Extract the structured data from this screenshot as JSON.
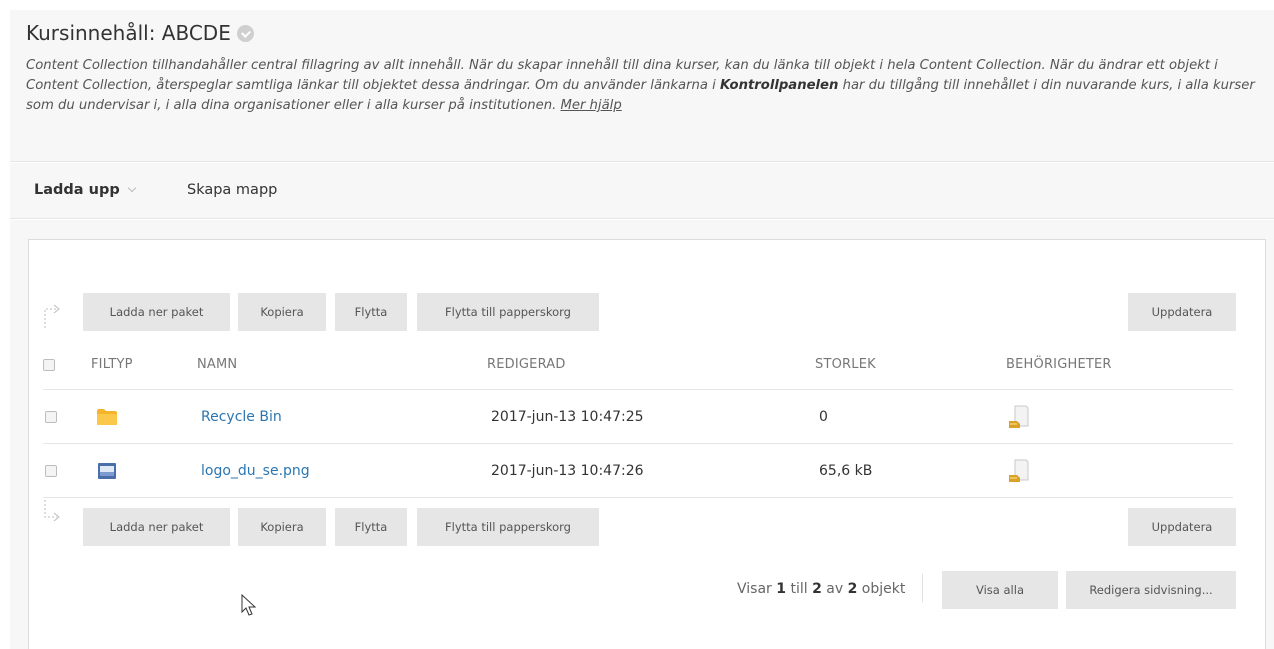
{
  "header": {
    "title": "Kursinnehåll: ABCDE",
    "description_part1": "Content Collection tillhandahåller central fillagring av allt innehåll. När du skapar innehåll till dina kurser, kan du länka till objekt i hela Content Collection. När du ändrar ett objekt i Content Collection, återspeglar samtliga länkar till objektet dessa ändringar. Om du använder länkarna i ",
    "description_bold": "Kontrollpanelen",
    "description_part2": " har du tillgång till innehållet i din nuvarande kurs, i alla kurser som du undervisar i, i alla dina organisationer eller i alla kurser på institutionen. ",
    "help_link": "Mer hjälp"
  },
  "actionbar": {
    "upload_label": "Ladda upp",
    "create_folder_label": "Skapa mapp"
  },
  "toolbar": {
    "download_package": "Ladda ner paket",
    "copy": "Kopiera",
    "move": "Flytta",
    "move_to_trash": "Flytta till papperskorg",
    "refresh": "Uppdatera"
  },
  "table": {
    "columns": {
      "filetype": "FILTYP",
      "name": "NAMN",
      "edited": "REDIGERAD",
      "size": "STORLEK",
      "permissions": "BEHÖRIGHETER"
    },
    "rows": [
      {
        "icon": "folder-icon",
        "name": "Recycle Bin",
        "edited": "2017-jun-13 10:47:25",
        "size": "0"
      },
      {
        "icon": "image-file-icon",
        "name": "logo_du_se.png",
        "edited": "2017-jun-13 10:47:26",
        "size": "65,6 kB"
      }
    ]
  },
  "footer": {
    "showing_prefix": "Visar ",
    "showing_from": "1",
    "showing_mid": " till ",
    "showing_to": "2",
    "showing_of": " av ",
    "showing_total": "2",
    "showing_suffix": " objekt",
    "show_all": "Visa alla",
    "edit_paging": "Redigera sidvisning..."
  },
  "colors": {
    "link": "#2b76b2",
    "button_bg": "#e6e6e6",
    "header_bg": "#f7f7f7",
    "folder": "#f5b52b"
  }
}
